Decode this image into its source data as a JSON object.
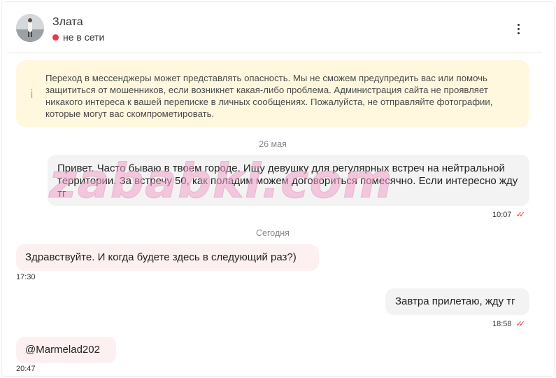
{
  "contact": {
    "name": "Злата",
    "status": "не в сети",
    "status_color": "#e8394a"
  },
  "warning": {
    "icon": "info-icon",
    "text": "Переход в мессенджеры может представлять опасность. Мы не сможем предупредить вас или помочь защититься от мошенников, если возникнет какая-либо проблема. Администрация сайта не проявляет никакого интереса к вашей переписке в личных сообщениях. Пожалуйста, не отправляйте фотографии, которые могут вас скомпрометировать."
  },
  "dates": {
    "first": "26 мая",
    "second": "Сегодня"
  },
  "messages": [
    {
      "direction": "out",
      "text": "Привет. Часто бываю в твоем городе. Ищу девушку для регулярных встреч на нейтральной территории. За встречу 50, как поладим можем договориться помесячно. Если интересно жду тг",
      "time": "10:07",
      "read": true
    },
    {
      "direction": "in",
      "text": "Здравствуйте. И когда будете здесь в следующий раз?)",
      "time": "17:30"
    },
    {
      "direction": "out",
      "text": "Завтра прилетаю, жду тг",
      "time": "18:58",
      "read": true
    },
    {
      "direction": "in",
      "text": "@Marmelad202",
      "time": "20:47"
    }
  ],
  "watermark": "zababki.com",
  "colors": {
    "accent": "#e8394a",
    "warning_bg": "#fff8df",
    "incoming_bg": "#fdf0f0",
    "outgoing_bg": "#f3f3f3"
  }
}
